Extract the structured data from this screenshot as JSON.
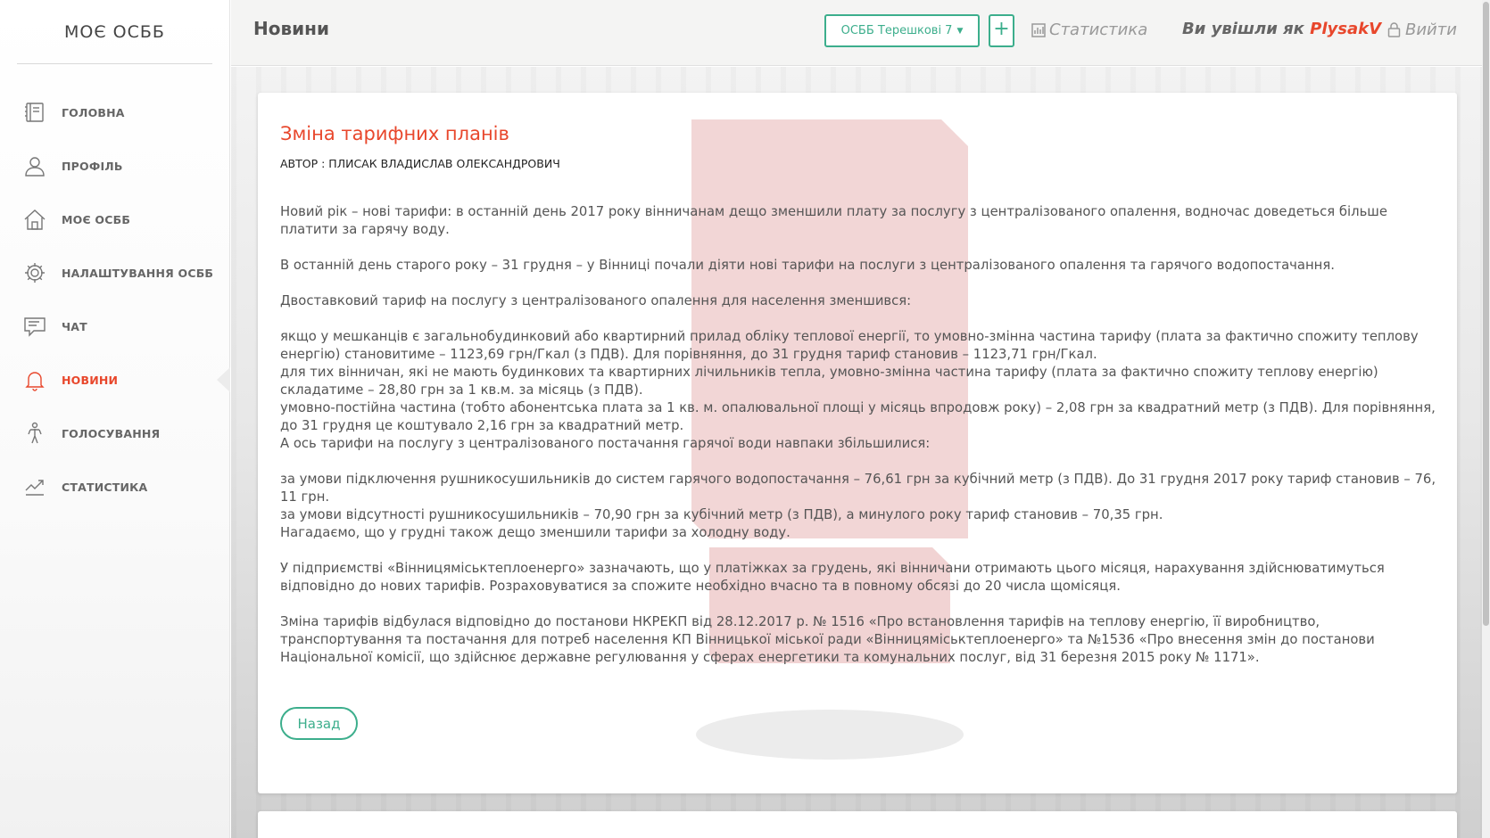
{
  "app": {
    "brand": "МОЄ ОСББ"
  },
  "sidebar": {
    "items": [
      {
        "label": "Головна",
        "icon": "book-icon",
        "active": false
      },
      {
        "label": "Профіль",
        "icon": "user-icon",
        "active": false
      },
      {
        "label": "Моє ОСББ",
        "icon": "home-icon",
        "active": false
      },
      {
        "label": "Налаштування ОСББ",
        "icon": "gear-icon",
        "active": false
      },
      {
        "label": "Чат",
        "icon": "chat-icon",
        "active": false
      },
      {
        "label": "Новини",
        "icon": "bell-icon",
        "active": true
      },
      {
        "label": "Голосування",
        "icon": "person-icon",
        "active": false
      },
      {
        "label": "Статистика",
        "icon": "trend-icon",
        "active": false
      }
    ]
  },
  "header": {
    "title": "Новини",
    "osbb_selected": "ОСББ Терешкові 7",
    "add_label": "+",
    "stats_label": "Статистика",
    "logged_prefix": "Ви увішли як",
    "username": "PlysakV",
    "logout_label": "Вийти"
  },
  "article": {
    "title": "Зміна тарифних планів",
    "author": "АВТОР : ПЛИСАК ВЛАДИСЛАВ ОЛЕКСАНДРОВИЧ",
    "back_label": "Назад",
    "paragraphs": [
      "Новий рік – нові тарифи: в останній день 2017 року вінничанам дещо зменшили плату за послугу з централізованого опалення, водночас доведеться більше платити за гарячу воду.",
      "",
      "В останній день старого року – 31 грудня – у Вінниці почали діяти нові тарифи на послуги з централізованого опалення та гарячого водопостачання.",
      "",
      "Двоставковий тариф на послугу з централізованого опалення для населення зменшився:",
      "",
      "якщо у мешканців є загальнобудинковий або квартирний прилад обліку теплової енергії, то умовно-змінна частина тарифу (плата за фактично спожиту теплову енергію) становитиме – 1123,69 грн/Гкал (з ПДВ). Для порівняння, до 31 грудня тариф становив – 1123,71 грн/Гкал.",
      "для тих вінничан, які не мають будинкових та квартирних лічильників тепла, умовно-змінна частина тарифу (плата за фактично спожиту теплову енергію) складатиме – 28,80 грн за 1 кв.м. за місяць (з ПДВ).",
      "умовно-постійна частина (тобто абонентська плата за 1 кв. м. опалювальної площі у місяць впродовж року) – 2,08 грн за квадратний метр (з ПДВ). Для порівняння, до 31 грудня це коштувало 2,16 грн за квадратний метр.",
      "А ось тарифи на послугу з централізованого постачання гарячої води навпаки збільшилися:",
      "",
      "за умови підключення рушникосушильників до систем гарячого водопостачання – 76,61 грн за кубічний метр (з ПДВ). До 31 грудня 2017 року тариф становив – 76, 11 грн.",
      "за умови відсутності рушникосушильників – 70,90 грн за кубічний метр (з ПДВ), а минулого року тариф становив – 70,35 грн.",
      "Нагадаємо, що у грудні також дещо зменшили тарифи за холодну воду.",
      "",
      "У підприємстві «Вінницяміськтеплоенерго» зазначають, що у платіжках за грудень, які вінничани отримають цього місяця, нарахування здійснюватимуться відповідно до нових тарифів. Розраховуватися за спожите необхідно вчасно та в повному обсязі до 20 числа щомісяця.",
      "",
      "Зміна тарифів відбулася відповідно до постанови НКРЕКП від 28.12.2017 р. № 1516 «Про встановлення тарифів на теплову енергію, її виробництво, транспортування та постачання для потреб населення КП Вінницької міської ради «Вінницяміськтеплоенерго» та №1536 «Про внесення змін до постанови Національної комісії, що здійснює державне регулювання у сферах енергетики та комунальних послуг, від 31 березня 2015 року № 1171»."
    ]
  },
  "colors": {
    "accent": "#e8472c",
    "green": "#3cae8c"
  }
}
